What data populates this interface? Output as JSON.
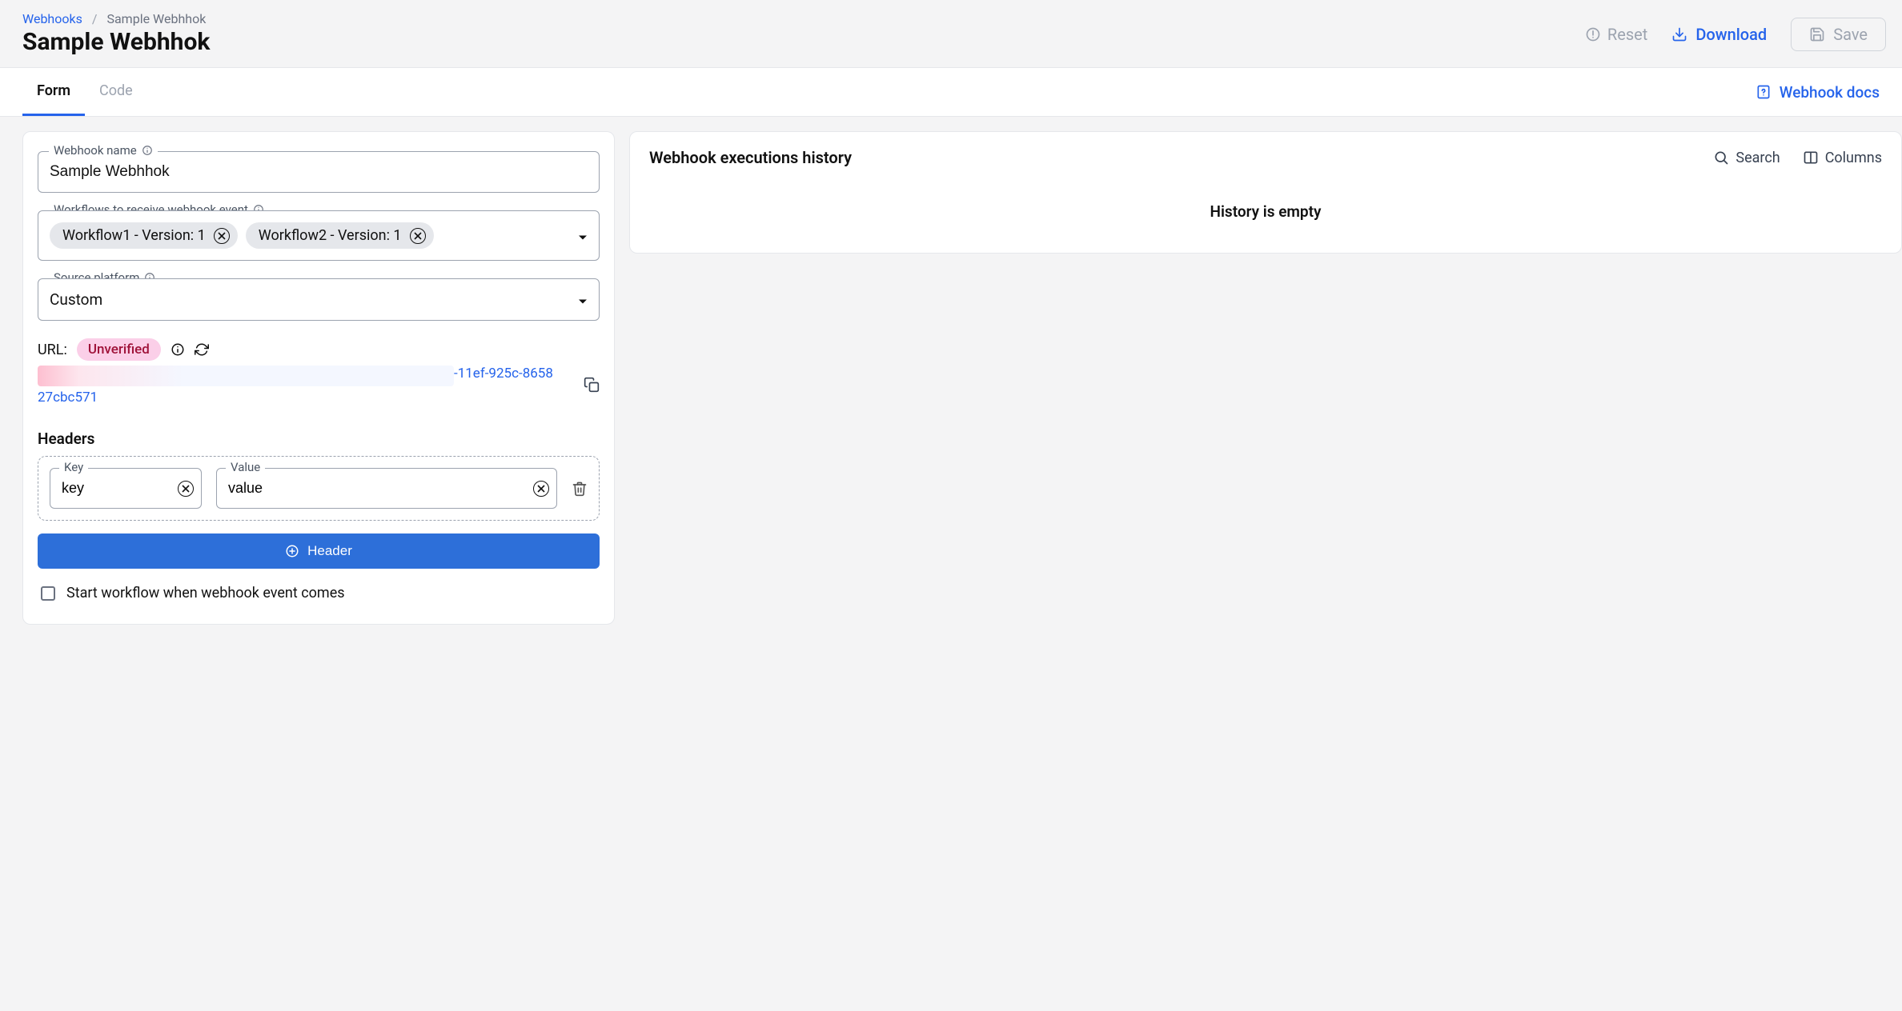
{
  "breadcrumb": {
    "root": "Webhooks",
    "current": "Sample Webhhok"
  },
  "page_title": "Sample Webhhok",
  "header_actions": {
    "reset": "Reset",
    "download": "Download",
    "save": "Save"
  },
  "tabs": {
    "form": "Form",
    "code": "Code"
  },
  "docs_link": "Webhook docs",
  "form": {
    "webhook_name": {
      "label": "Webhook name",
      "value": "Sample Webhhok"
    },
    "workflows": {
      "label": "Workflows to receive webhook event",
      "chips": [
        "Workflow1 - Version: 1",
        "Workflow2 - Version: 1"
      ]
    },
    "source_platform": {
      "label": "Source platform",
      "value": "Custom"
    },
    "url": {
      "prefix": "URL:",
      "badge": "Unverified",
      "visible_suffix": "-11ef-925c-8658",
      "visible_line2": "27cbc571"
    },
    "headers": {
      "title": "Headers",
      "rows": [
        {
          "key_label": "Key",
          "key": "key",
          "value_label": "Value",
          "value": "value"
        }
      ],
      "add_button": "Header"
    },
    "start_workflow_checkbox": {
      "label": "Start workflow when webhook event comes",
      "checked": false
    }
  },
  "history": {
    "title": "Webhook executions history",
    "search": "Search",
    "columns": "Columns",
    "empty": "History is empty"
  }
}
